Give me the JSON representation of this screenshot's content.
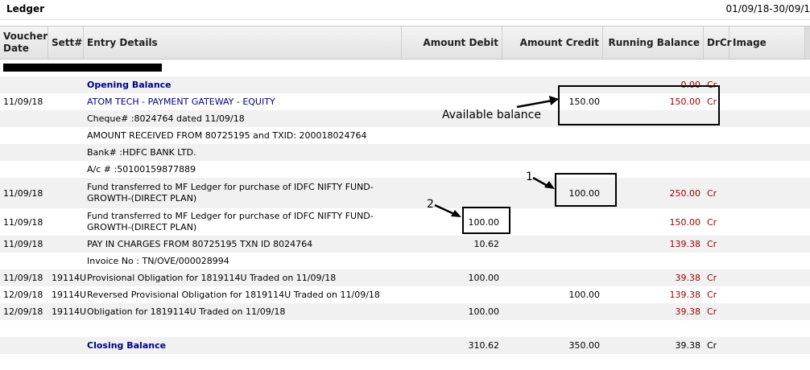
{
  "header": {
    "title": "Ledger",
    "date_range": "01/09/18-30/09/1"
  },
  "columns": [
    "Voucher Date",
    "Sett#",
    "Entry Details",
    "Amount Debit",
    "Amount Credit",
    "Running Balance",
    "DrCr",
    "Image"
  ],
  "rows": [
    {
      "date": "",
      "sett": "",
      "entry": "Opening Balance",
      "debit": "",
      "credit": "",
      "balance": "0.00",
      "drcr": "Cr",
      "style": "bold"
    },
    {
      "date": "11/09/18",
      "sett": "",
      "entry": "ATOM TECH - PAYMENT GATEWAY - EQUITY",
      "debit": "",
      "credit": "150.00",
      "balance": "150.00",
      "drcr": "Cr",
      "style": "link"
    },
    {
      "date": "",
      "sett": "",
      "entry": "Cheque# :8024764 dated 11/09/18",
      "debit": "",
      "credit": "",
      "balance": "",
      "drcr": "",
      "style": ""
    },
    {
      "date": "",
      "sett": "",
      "entry": "AMOUNT RECEIVED FROM 80725195 and TXID: 200018024764",
      "debit": "",
      "credit": "",
      "balance": "",
      "drcr": "",
      "style": ""
    },
    {
      "date": "",
      "sett": "",
      "entry": "Bank# :HDFC BANK LTD.",
      "debit": "",
      "credit": "",
      "balance": "",
      "drcr": "",
      "style": ""
    },
    {
      "date": "",
      "sett": "",
      "entry": "A/c # :50100159877889",
      "debit": "",
      "credit": "",
      "balance": "",
      "drcr": "",
      "style": ""
    },
    {
      "date": "11/09/18",
      "sett": "",
      "entry": "Fund transferred to MF Ledger for purchase of  IDFC NIFTY FUND-GROWTH-(DIRECT PLAN)",
      "debit": "",
      "credit": "100.00",
      "balance": "250.00",
      "drcr": "Cr",
      "style": ""
    },
    {
      "date": "11/09/18",
      "sett": "",
      "entry": "Fund transferred to MF Ledger for purchase of  IDFC NIFTY FUND-GROWTH-(DIRECT PLAN)",
      "debit": "100.00",
      "credit": "",
      "balance": "150.00",
      "drcr": "Cr",
      "style": ""
    },
    {
      "date": "11/09/18",
      "sett": "",
      "entry": "PAY IN CHARGES FROM 80725195 TXN ID 8024764",
      "debit": "10.62",
      "credit": "",
      "balance": "139.38",
      "drcr": "Cr",
      "style": ""
    },
    {
      "date": "",
      "sett": "",
      "entry": "Invoice No : TN/OVE/000028994",
      "debit": "",
      "credit": "",
      "balance": "",
      "drcr": "",
      "style": ""
    },
    {
      "date": "11/09/18",
      "sett": "19114U",
      "entry": "Provisional Obligation for 1819114U Traded on 11/09/18",
      "debit": "100.00",
      "credit": "",
      "balance": "39.38",
      "drcr": "Cr",
      "style": ""
    },
    {
      "date": "12/09/18",
      "sett": "19114U",
      "entry": "Reversed Provisional Obligation for 1819114U Traded on 11/09/18",
      "debit": "",
      "credit": "100.00",
      "balance": "139.38",
      "drcr": "Cr",
      "style": ""
    },
    {
      "date": "12/09/18",
      "sett": "19114U",
      "entry": "Obligation for 1819114U Traded on 11/09/18",
      "debit": "100.00",
      "credit": "",
      "balance": "39.38",
      "drcr": "Cr",
      "style": ""
    },
    {
      "date": "",
      "sett": "",
      "entry": "",
      "debit": "",
      "credit": "",
      "balance": "",
      "drcr": "",
      "style": ""
    },
    {
      "date": "",
      "sett": "",
      "entry": "Closing Balance",
      "debit": "310.62",
      "credit": "350.00",
      "balance": "39.38",
      "drcr": "Cr",
      "style": "bold"
    }
  ],
  "annotations": {
    "available_label": "Available balance",
    "marker_1": "1",
    "marker_2": "2"
  }
}
